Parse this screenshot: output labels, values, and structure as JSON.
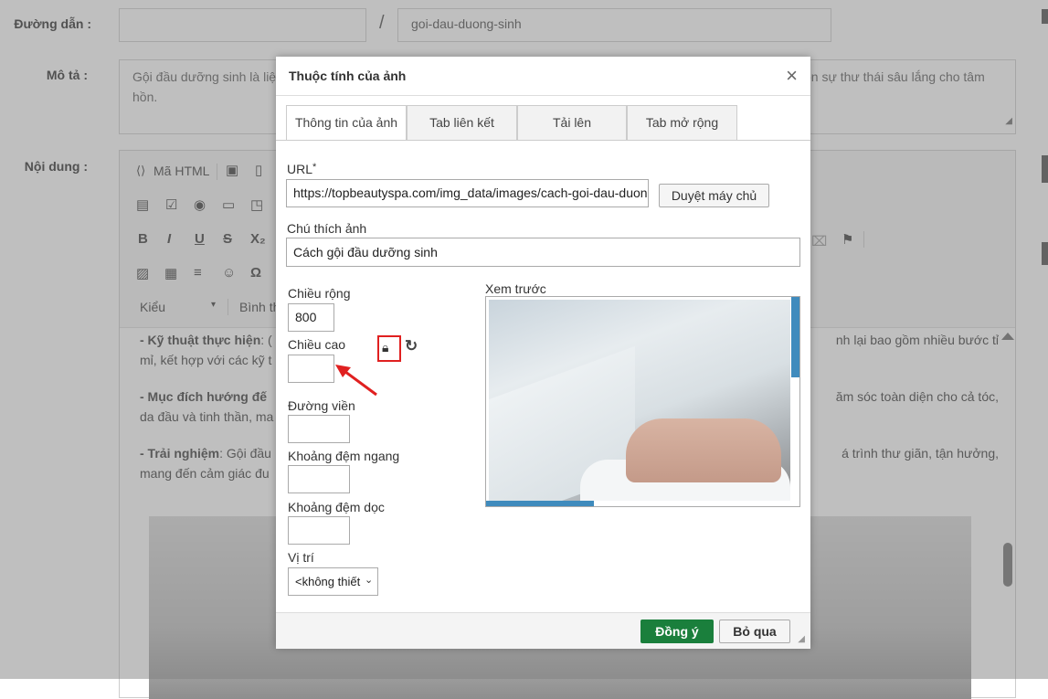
{
  "form": {
    "path_label": "Đường dẫn :",
    "slug_separator": "/",
    "slug_value": "goi-dau-duong-sinh",
    "desc_label": "Mô tả :",
    "desc_value_left": "Gội đầu dưỡng sinh là liệu",
    "desc_value_right": "còn sự thư thái sâu lắng cho tâm",
    "desc_value_line2": "hồn.",
    "content_label": "Nội dung :"
  },
  "editor": {
    "source_button": "Mã HTML",
    "style_select": "Kiểu",
    "format_select": "Bình th",
    "paragraphs": [
      {
        "bold": "- Kỹ thuật thực hiện",
        "rest": ": (",
        "right": "nh lại bao gồm nhiều bước tỉ",
        "line2": "mỉ, kết hợp với các kỹ t"
      },
      {
        "bold": "- Mục đích hướng đế",
        "rest": "",
        "right": "ăm sóc toàn diện cho cả tóc,",
        "line2": "da đầu và tinh thần, ma"
      },
      {
        "bold": "- Trải nghiệm",
        "rest": ": Gội đầu",
        "right": "á trình thư giãn, tận hưởng,",
        "line2": "mang đến cảm giác đu"
      }
    ]
  },
  "dialog": {
    "title": "Thuộc tính của ảnh",
    "close_symbol": "×",
    "tabs": [
      "Thông tin của ảnh",
      "Tab liên kết",
      "Tải lên",
      "Tab mở rộng"
    ],
    "url_label": "URL",
    "url_required": "*",
    "url_value": "https://topbeautyspa.com/img_data/images/cach-goi-dau-duong",
    "browse_button": "Duyệt máy chủ",
    "alt_label": "Chú thích ảnh",
    "alt_value": "Cách gội đầu dưỡng sinh",
    "width_label": "Chiều rộng",
    "width_value": "800",
    "height_label": "Chiều cao",
    "height_value": "",
    "border_label": "Đường viền",
    "hspace_label": "Khoảng đệm ngang",
    "vspace_label": "Khoảng đệm dọc",
    "align_label": "Vị trí",
    "align_value": "<không thiết",
    "preview_label": "Xem trước",
    "ok_button": "Đồng ý",
    "cancel_button": "Bỏ qua"
  },
  "colors": {
    "ok_green": "#1a7f3c",
    "highlight_red": "#e02020",
    "scroll_blue": "#3f8bbd"
  }
}
